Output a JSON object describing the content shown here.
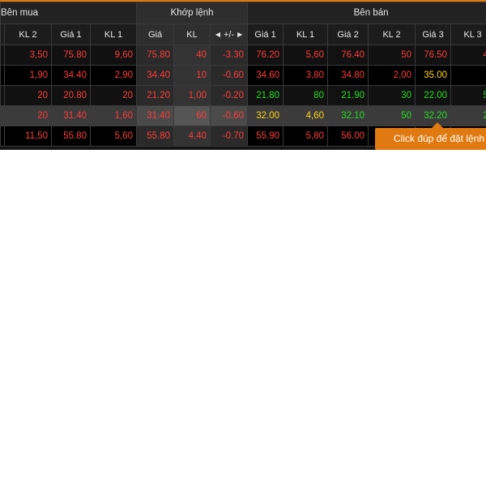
{
  "groups": {
    "buy": "Bên mua",
    "match": "Khớp lệnh",
    "sell": "Bên bán"
  },
  "columns": {
    "buy_kl2": "KL 2",
    "buy_gia1": "Giá 1",
    "buy_kl1": "KL 1",
    "match_gia": "Giá",
    "match_kl": "KL",
    "match_change": "+/-",
    "sell_gia1": "Giá 1",
    "sell_kl1": "KL 1",
    "sell_gia2": "Giá 2",
    "sell_kl2": "KL 2",
    "sell_gia3": "Giá 3",
    "sell_kl3": "KL 3"
  },
  "rows": [
    [
      "",
      "3,50",
      "75.80",
      "9,60",
      "75.80",
      "40",
      "-3.30",
      "76.20",
      "5,60",
      "76.40",
      "50",
      "76.50",
      "4,"
    ],
    [
      "",
      "1,90",
      "34.40",
      "2,90",
      "34.40",
      "10",
      "-0.60",
      "34.60",
      "3,80",
      "34.80",
      "2,00",
      "35.00",
      ""
    ],
    [
      "",
      "20",
      "20.80",
      "20",
      "21.20",
      "1,00",
      "-0.20",
      "21.80",
      "80",
      "21.90",
      "30",
      "22.00",
      "5,"
    ],
    [
      "",
      "20",
      "31.40",
      "1,60",
      "31.40",
      "60",
      "-0.60",
      "32.00",
      "4,60",
      "32.10",
      "50",
      "32.20",
      "2,"
    ],
    [
      "",
      "11,50",
      "55.80",
      "5,60",
      "55.80",
      "4,40",
      "-0.70",
      "55.90",
      "5,80",
      "56.00",
      "",
      "",
      ""
    ]
  ],
  "tooltip": "Click đúp để đặt lệnh",
  "colors": {
    "accent": "#e07a10",
    "down": "#ff3b3b",
    "up": "#22dd22",
    "reference": "#ffd21a"
  }
}
